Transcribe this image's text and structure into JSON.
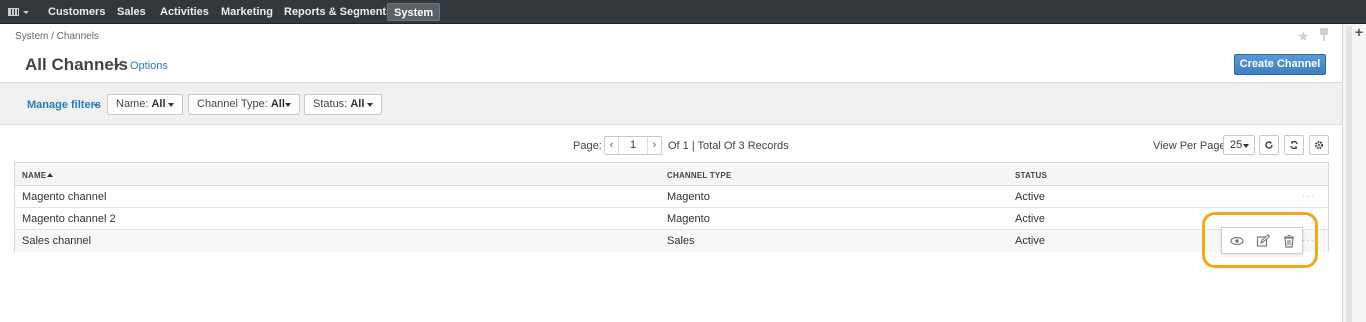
{
  "nav": {
    "items": [
      "Customers",
      "Sales",
      "Activities",
      "Marketing",
      "Reports & Segments",
      "System"
    ],
    "active": "System"
  },
  "breadcrumb": "System / Channels",
  "page": {
    "title": "All Channels",
    "options_link": "Options",
    "create_button": "Create Channel"
  },
  "filters": {
    "manage": "Manage filters",
    "items": [
      {
        "label": "Name:",
        "value": "All"
      },
      {
        "label": "Channel Type:",
        "value": "All"
      },
      {
        "label": "Status:",
        "value": "All"
      }
    ]
  },
  "pager": {
    "label": "Page:",
    "current": "1",
    "info": "Of 1 | Total Of 3 Records",
    "view_per_page_label": "View Per Page:",
    "per_page": "25"
  },
  "grid": {
    "columns": [
      "NAME",
      "CHANNEL TYPE",
      "STATUS"
    ],
    "rows": [
      {
        "name": "Magento channel",
        "type": "Magento",
        "status": "Active"
      },
      {
        "name": "Magento channel 2",
        "type": "Magento",
        "status": "Active"
      },
      {
        "name": "Sales channel",
        "type": "Sales",
        "status": "Active"
      }
    ]
  },
  "row_actions": [
    "view-icon",
    "edit-icon",
    "delete-icon"
  ],
  "colors": {
    "accent": "#3f7fc1",
    "link": "#2a7ab8",
    "highlight": "#f0a81e",
    "nav_bg": "#33383d"
  }
}
